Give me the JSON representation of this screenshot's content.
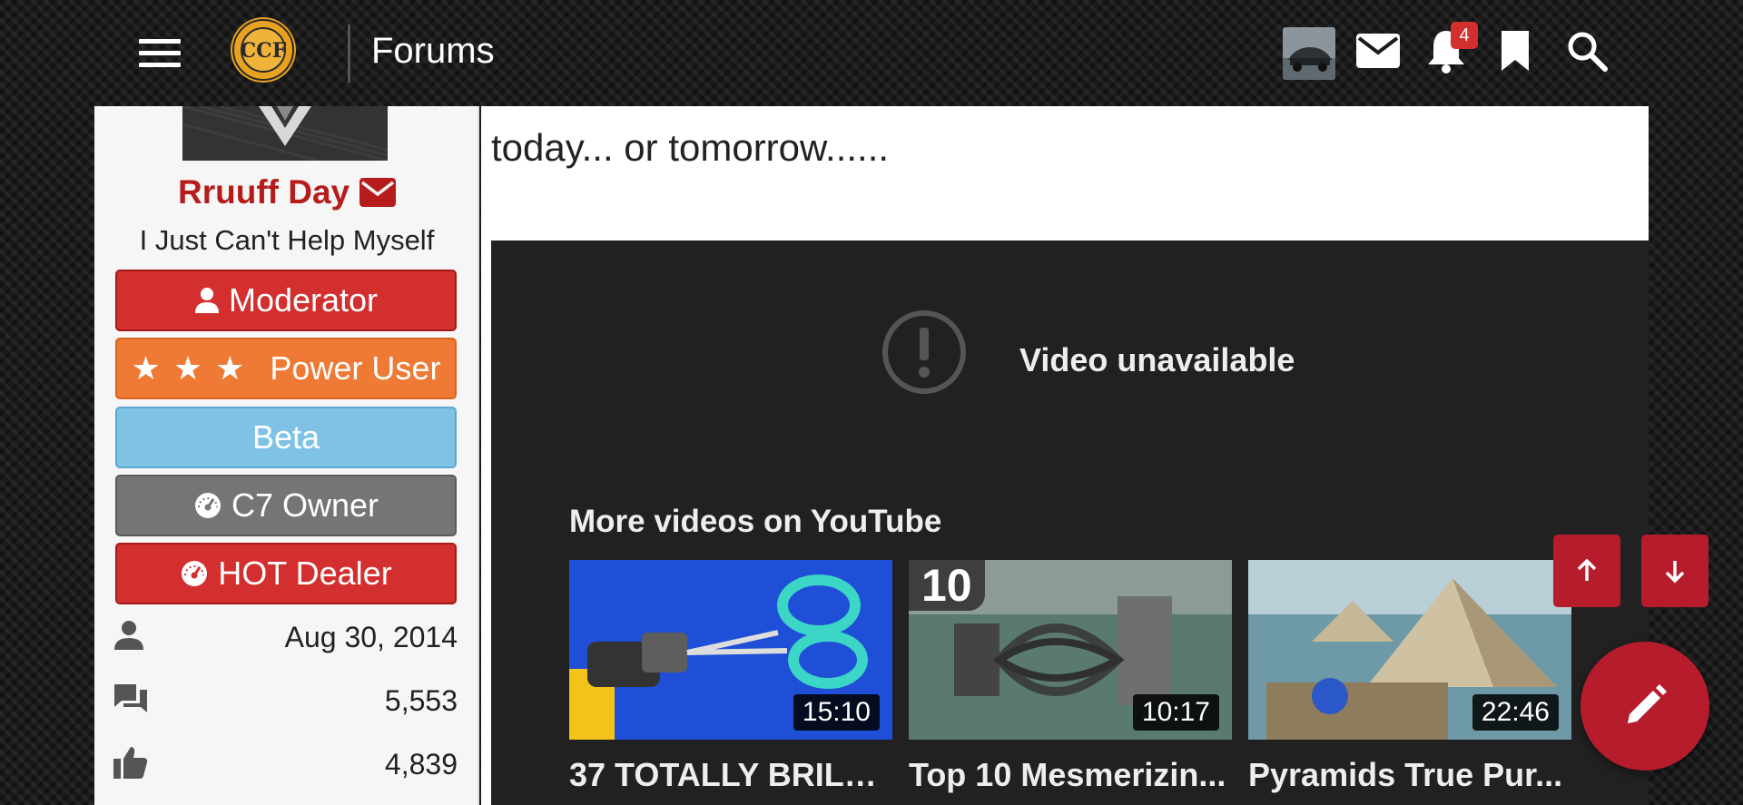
{
  "header": {
    "menu_icon": "hamburger-menu-icon",
    "logo_text": "CCF",
    "logo_ring_text": "CANADIAN CORVETTE FORUMS",
    "forums_label": "Forums",
    "notification_count": "4",
    "icons": [
      "avatar-thumbnail",
      "mail-icon",
      "bell-icon",
      "bookmark-icon",
      "search-icon"
    ]
  },
  "user": {
    "name": "Rruuff Day",
    "title": "I Just Can't Help Myself",
    "badges": {
      "moderator": "Moderator",
      "power_stars": "★★★",
      "power": "Power User",
      "beta": "Beta",
      "c7": "C7 Owner",
      "hot": "HOT Dealer"
    },
    "stats": {
      "joined": "Aug 30, 2014",
      "messages": "5,553",
      "reactions": "4,839"
    }
  },
  "post": {
    "text": "today... or tomorrow......"
  },
  "video": {
    "unavailable": "Video unavailable",
    "more_title": "More videos on YouTube",
    "items": [
      {
        "title": "37 TOTALLY BRILLI...",
        "duration": "15:10"
      },
      {
        "title": "Top 10 Mesmerizin...",
        "duration": "10:17",
        "rank": "10"
      },
      {
        "title": "Pyramids True Pur...",
        "duration": "22:46"
      }
    ]
  },
  "colors": {
    "accent": "#b71c2c",
    "moderator": "#d32f2f",
    "power_user": "#ee7a35",
    "beta": "#7fc2e6",
    "c7_owner": "#757575",
    "hot_dealer": "#d32f2f"
  }
}
